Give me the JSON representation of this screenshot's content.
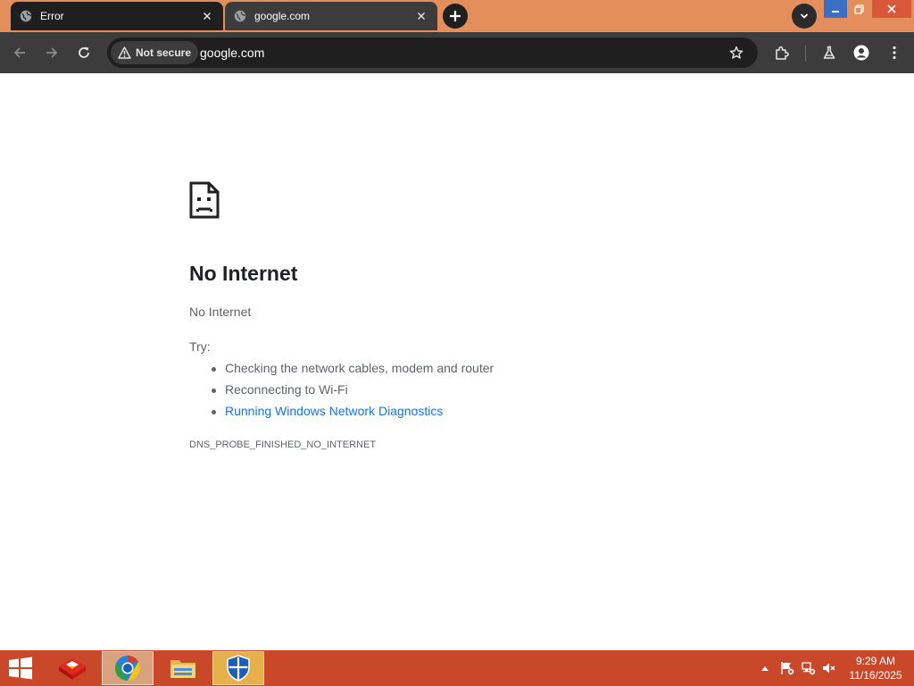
{
  "browser": {
    "tabs": [
      {
        "title": "Error",
        "active": false,
        "favicon": "globe-icon"
      },
      {
        "title": "google.com",
        "active": true,
        "favicon": "globe-icon"
      }
    ],
    "omnibox": {
      "security_chip": "Not secure",
      "url": "google.com"
    },
    "colors": {
      "tabstrip": "#e48e5c",
      "toolbar": "#3c3c3c",
      "omnibox": "#1f1f1f"
    }
  },
  "error_page": {
    "icon": "sad-page-icon",
    "title": "No Internet",
    "subtitle": "No Internet",
    "try_label": "Try:",
    "suggestions": [
      "Checking the network cables, modem and router",
      "Reconnecting to Wi-Fi",
      "Running Windows Network Diagnostics"
    ],
    "error_code": "DNS_PROBE_FINISHED_NO_INTERNET",
    "link_color": "#1a73e8"
  },
  "taskbar": {
    "color": "#c9482a",
    "apps": [
      "toolbox-app-icon",
      "chrome-app-icon",
      "file-explorer-icon",
      "shield-app-icon"
    ],
    "clock": {
      "time": "9:29 AM",
      "date": "11/16/2025"
    }
  }
}
